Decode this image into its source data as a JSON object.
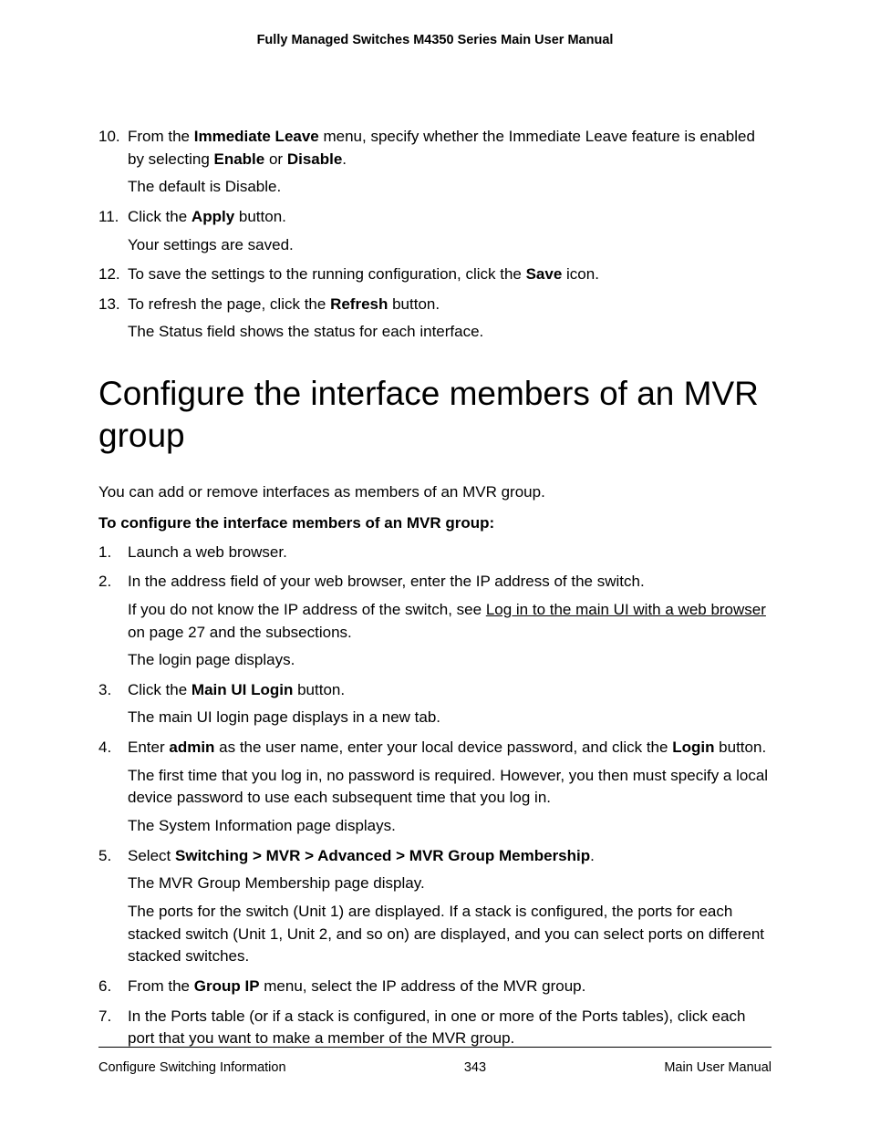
{
  "header": {
    "title": "Fully Managed Switches M4350 Series Main User Manual"
  },
  "steps_continued": {
    "s10_num": "10.",
    "s10_a": "From the ",
    "s10_b": "Immediate Leave",
    "s10_c": " menu, specify whether the Immediate Leave feature is enabled by selecting ",
    "s10_d": "Enable",
    "s10_e": " or ",
    "s10_f": "Disable",
    "s10_g": ".",
    "s10_sub": "The default is Disable.",
    "s11_num": "11.",
    "s11_a": "Click the ",
    "s11_b": "Apply",
    "s11_c": " button.",
    "s11_sub": "Your settings are saved.",
    "s12_num": "12.",
    "s12_a": "To save the settings to the running configuration, click the ",
    "s12_b": "Save",
    "s12_c": " icon.",
    "s13_num": "13.",
    "s13_a": "To refresh the page, click the ",
    "s13_b": "Refresh",
    "s13_c": " button.",
    "s13_sub": "The Status field shows the status for each interface."
  },
  "section": {
    "title": "Configure the interface members of an MVR group",
    "intro": "You can add or remove interfaces as members of an MVR group.",
    "proc_heading": "To configure the interface members of an MVR group:"
  },
  "steps_new": {
    "s1_num": "1.",
    "s1": "Launch a web browser.",
    "s2_num": "2.",
    "s2": "In the address field of your web browser, enter the IP address of the switch.",
    "s2_sub_a": "If you do not know the IP address of the switch, see ",
    "s2_sub_link": "Log in to the main UI with a web browser",
    "s2_sub_b": " on page 27 and the subsections.",
    "s2_sub2": "The login page displays.",
    "s3_num": "3.",
    "s3_a": "Click the ",
    "s3_b": "Main UI Login",
    "s3_c": " button.",
    "s3_sub": "The main UI login page displays in a new tab.",
    "s4_num": "4.",
    "s4_a": "Enter ",
    "s4_b": "admin",
    "s4_c": " as the user name, enter your local device password, and click the ",
    "s4_d": "Login",
    "s4_e": " button.",
    "s4_sub1": "The first time that you log in, no password is required. However, you then must specify a local device password to use each subsequent time that you log in.",
    "s4_sub2": "The System Information page displays.",
    "s5_num": "5.",
    "s5_a": "Select ",
    "s5_b": "Switching > MVR > Advanced > MVR Group Membership",
    "s5_c": ".",
    "s5_sub1": "The MVR Group Membership page display.",
    "s5_sub2": "The ports for the switch (Unit 1) are displayed. If a stack is configured, the ports for each stacked switch (Unit 1, Unit 2, and so on) are displayed, and you can select ports on different stacked switches.",
    "s6_num": "6.",
    "s6_a": "From the ",
    "s6_b": "Group IP",
    "s6_c": " menu, select the IP address of the MVR group.",
    "s7_num": "7.",
    "s7": "In the Ports table (or if a stack is configured, in one or more of the Ports tables), click each port that you want to make a member of the MVR group."
  },
  "footer": {
    "left": "Configure Switching Information",
    "center": "343",
    "right": "Main User Manual"
  }
}
